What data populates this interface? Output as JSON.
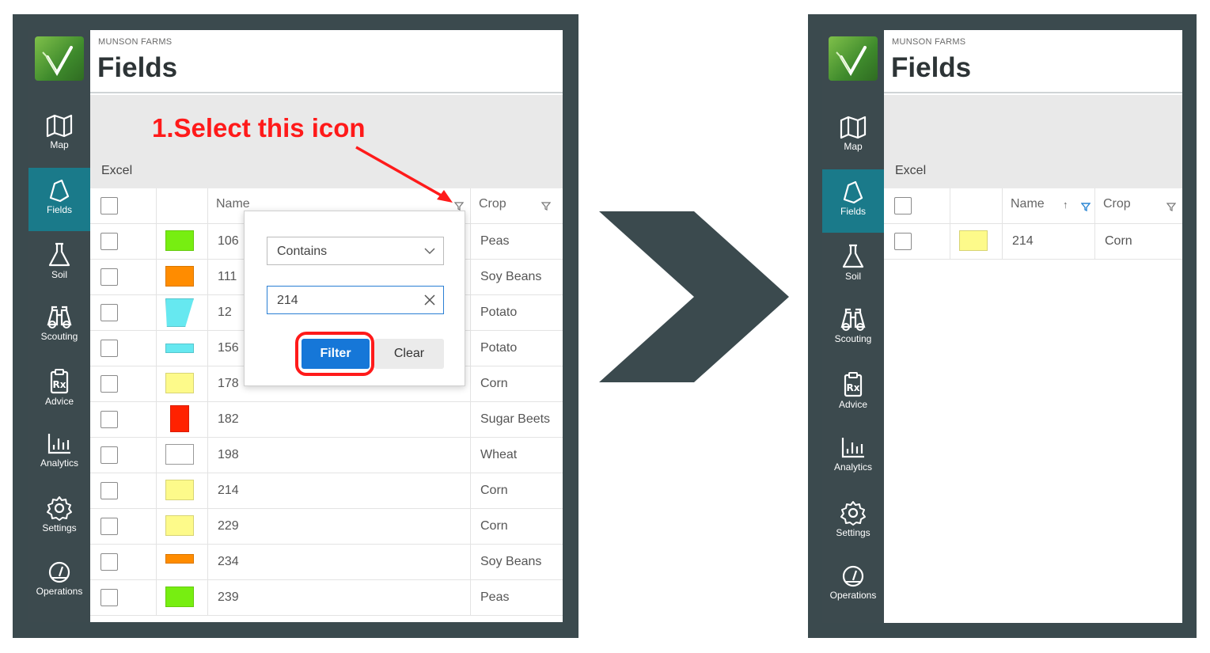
{
  "brand": {
    "farm_name": "MUNSON FARMS",
    "page_title": "Fields",
    "accent": "#1a7a8a",
    "sidebar_bg": "#3c4a4e"
  },
  "nav": [
    {
      "label": "Map",
      "icon": "map-icon"
    },
    {
      "label": "Fields",
      "icon": "field-icon",
      "active": true
    },
    {
      "label": "Soil",
      "icon": "flask-icon"
    },
    {
      "label": "Scouting",
      "icon": "binoculars-icon"
    },
    {
      "label": "Advice",
      "icon": "prescription-clipboard-icon"
    },
    {
      "label": "Analytics",
      "icon": "bar-chart-icon"
    },
    {
      "label": "Settings",
      "icon": "gear-icon"
    },
    {
      "label": "Operations",
      "icon": "gauge-icon"
    }
  ],
  "toolbar": {
    "excel_label": "Excel"
  },
  "columns": {
    "name": "Name",
    "crop": "Crop"
  },
  "annotation": {
    "text": "1.Select this icon",
    "color": "#ff1a1a"
  },
  "filter_popup": {
    "operator": "Contains",
    "value": "214",
    "filter_label": "Filter",
    "clear_label": "Clear"
  },
  "left_rows": [
    {
      "name": "106",
      "crop": "Peas",
      "color": "#77ee11"
    },
    {
      "name": "111",
      "crop": "Soy Beans",
      "color": "#ff8c00"
    },
    {
      "name": "12",
      "crop": "Potato",
      "color": "#66e8f0"
    },
    {
      "name": "156",
      "crop": "Potato",
      "color": "#66e8f0"
    },
    {
      "name": "178",
      "crop": "Corn",
      "color": "#fdfa8a"
    },
    {
      "name": "182",
      "crop": "Sugar Beets",
      "color": "#ff2200"
    },
    {
      "name": "198",
      "crop": "Wheat",
      "color": "#ffffff"
    },
    {
      "name": "214",
      "crop": "Corn",
      "color": "#fdfa8a"
    },
    {
      "name": "229",
      "crop": "Corn",
      "color": "#fdfa8a"
    },
    {
      "name": "234",
      "crop": "Soy Beans",
      "color": "#ff8c00"
    },
    {
      "name": "239",
      "crop": "Peas",
      "color": "#77ee11"
    }
  ],
  "right_rows": [
    {
      "name": "214",
      "crop": "Corn",
      "color": "#fdfa8a"
    }
  ]
}
